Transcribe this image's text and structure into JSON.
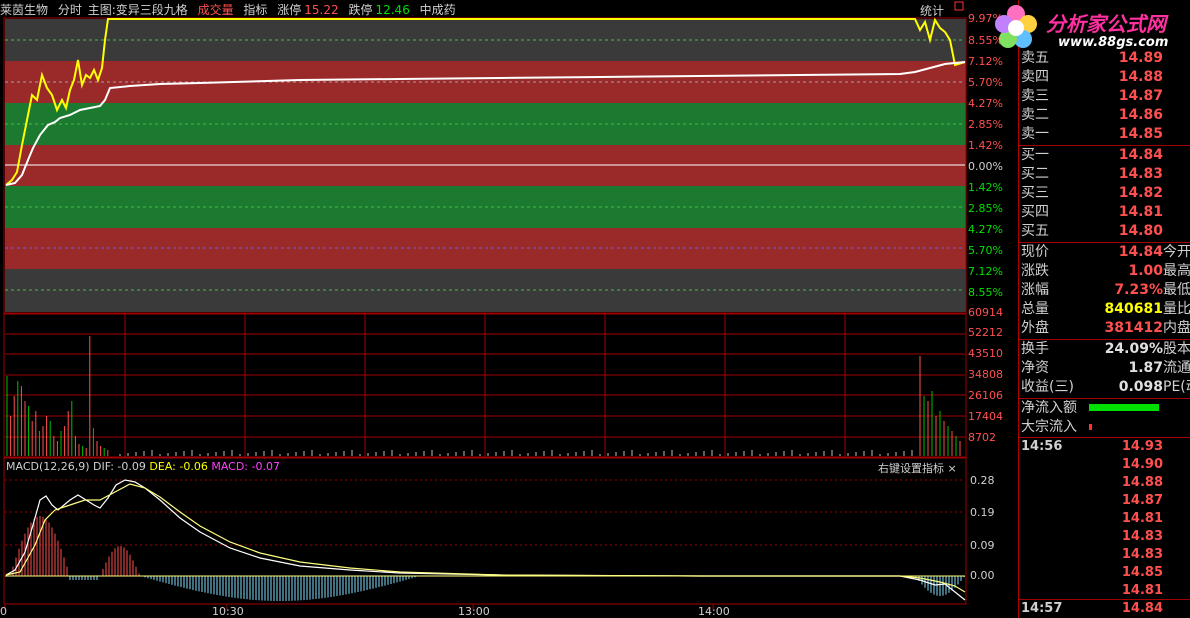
{
  "topbar": {
    "stock_name": "莱茵生物",
    "mode": "分时",
    "main_chart": "主图:变异三段九格",
    "volume_label": "成交量",
    "indicator": "指标",
    "limit_up_label": "涨停",
    "limit_up_value": "15.22",
    "limit_down_label": "跌停",
    "limit_down_value": "12.46",
    "sector": "中成药",
    "stats_button": "统计"
  },
  "watermark": {
    "title": "分析家公式网",
    "url": "www.88gs.com"
  },
  "price_axis": {
    "labels": [
      "9.97%",
      "8.55%",
      "7.12%",
      "5.70%",
      "4.27%",
      "2.85%",
      "1.42%",
      "0.00%",
      "1.42%",
      "2.85%",
      "4.27%",
      "5.70%",
      "7.12%",
      "8.55%"
    ]
  },
  "volume_axis": {
    "labels": [
      "60914",
      "52212",
      "43510",
      "34808",
      "26106",
      "17404",
      "8702"
    ]
  },
  "macd": {
    "title": "MACD(12,26,9)",
    "dif": "DIF: -0.09",
    "dea": "DEA: -0.06",
    "macd": "MACD: -0.07",
    "settings": "右键设置指标",
    "close": "×",
    "axis_labels": [
      "0.28",
      "0.19",
      "0.09",
      "0.00"
    ]
  },
  "time_axis": {
    "labels": [
      "0",
      "10:30",
      "13:00",
      "14:00"
    ]
  },
  "order_book": {
    "sells": [
      {
        "label": "卖五",
        "price": "14.89"
      },
      {
        "label": "卖四",
        "price": "14.88"
      },
      {
        "label": "卖三",
        "price": "14.87"
      },
      {
        "label": "卖二",
        "price": "14.86"
      },
      {
        "label": "卖一",
        "price": "14.85"
      }
    ],
    "buys": [
      {
        "label": "买一",
        "price": "14.84"
      },
      {
        "label": "买二",
        "price": "14.83"
      },
      {
        "label": "买三",
        "price": "14.82"
      },
      {
        "label": "买四",
        "price": "14.81"
      },
      {
        "label": "买五",
        "price": "14.80"
      }
    ]
  },
  "quote": [
    {
      "label": "现价",
      "value": "14.84",
      "label2": "今开",
      "color": "#ff5050"
    },
    {
      "label": "涨跌",
      "value": "1.00",
      "label2": "最高",
      "color": "#ff5050"
    },
    {
      "label": "涨幅",
      "value": "7.23%",
      "label2": "最低",
      "color": "#ff5050"
    },
    {
      "label": "总量",
      "value": "840681",
      "label2": "量比",
      "color": "#ffff00"
    },
    {
      "label": "外盘",
      "value": "381412",
      "label2": "内盘",
      "color": "#ff5050"
    }
  ],
  "fundamentals": [
    {
      "label": "换手",
      "value": "24.09%",
      "label2": "股本"
    },
    {
      "label": "净资",
      "value": "1.87",
      "label2": "流通"
    },
    {
      "label": "收益(三)",
      "value": "0.098",
      "label2": "PE(动)"
    }
  ],
  "flows": {
    "net_inflow": "净流入额",
    "block_inflow": "大宗流入"
  },
  "ticks": {
    "time1": "14:56",
    "prices": [
      "14.93",
      "14.90",
      "14.88",
      "14.87",
      "14.81",
      "14.83",
      "14.83",
      "14.85",
      "14.81"
    ],
    "time2": "14:57",
    "last_price": "14.84"
  },
  "colors": {
    "up": "#ff5050",
    "down": "#00e000",
    "bg": "#000000",
    "grid": "#a00000",
    "price_line": "#ffff00",
    "avg_line": "#ffffff"
  }
}
